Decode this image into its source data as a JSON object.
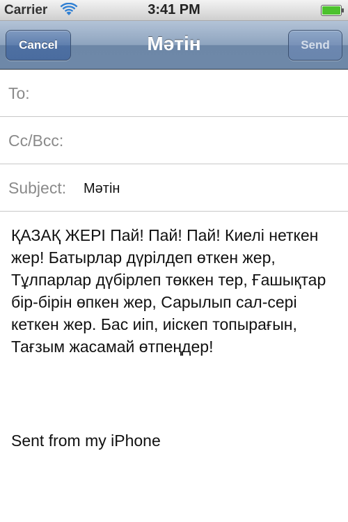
{
  "status_bar": {
    "carrier": "Carrier",
    "time": "3:41 PM",
    "battery_level": 1.0
  },
  "nav_bar": {
    "cancel_label": "Cancel",
    "title": "Мәтін",
    "send_label": "Send"
  },
  "fields": {
    "to_label": "To:",
    "cc_label": "Cc/Bcc:",
    "subject_label": "Subject:",
    "subject_value": "Мәтін"
  },
  "message": {
    "body": "ҚАЗАҚ ЖЕРІ Пай! Пай! Пай! Киелі неткен жер! Батырлар дүрілдеп өткен жер, Тұлпарлар дүбірлеп төккен тер, Ғашықтар бір-бірін өпкен жер, Сарылып сал-сері кеткен жер. Бас иіп, иіскеп топырағын, Тағзым жасамай өтпеңдер!",
    "signature": "Sent from my iPhone"
  },
  "colors": {
    "nav_bar": "#8ea4bf",
    "button": "#4e70a2",
    "label_gray": "#8a8a8a"
  }
}
